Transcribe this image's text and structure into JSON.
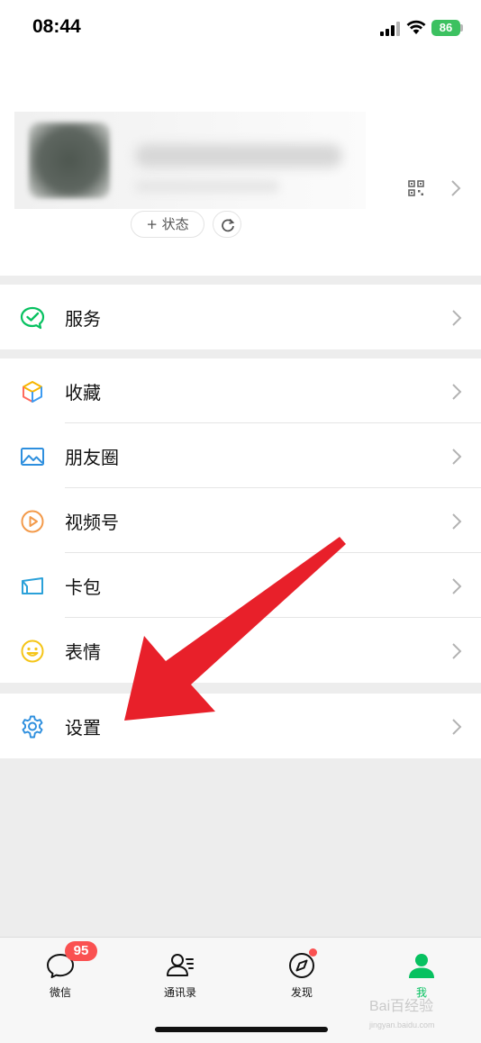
{
  "status_bar": {
    "time": "08:44",
    "battery": "86"
  },
  "profile": {
    "status_button_label": "+ 状态"
  },
  "menu": {
    "service": {
      "label": "服务",
      "icon": "service-icon"
    },
    "items": [
      {
        "label": "收藏",
        "icon": "favorites-cube-icon"
      },
      {
        "label": "朋友圈",
        "icon": "moments-image-icon"
      },
      {
        "label": "视频号",
        "icon": "channels-play-icon"
      },
      {
        "label": "卡包",
        "icon": "card-wallet-icon"
      },
      {
        "label": "表情",
        "icon": "emoji-smile-icon"
      }
    ],
    "settings": {
      "label": "设置",
      "icon": "gear-icon"
    }
  },
  "tabbar": {
    "tabs": [
      {
        "label": "微信",
        "icon": "chat-bubble-icon"
      },
      {
        "label": "通讯录",
        "icon": "contacts-icon"
      },
      {
        "label": "发现",
        "icon": "compass-icon"
      },
      {
        "label": "我",
        "icon": "person-icon"
      }
    ],
    "chats_badge": "95",
    "active_tab": "我"
  },
  "watermark": {
    "text": "Bai百经验",
    "sub": "jingyan.baidu.com"
  },
  "colors": {
    "accent_green": "#07c160",
    "badge_red": "#fa5151",
    "annotation_arrow": "#e8202a",
    "background": "#ededed"
  }
}
